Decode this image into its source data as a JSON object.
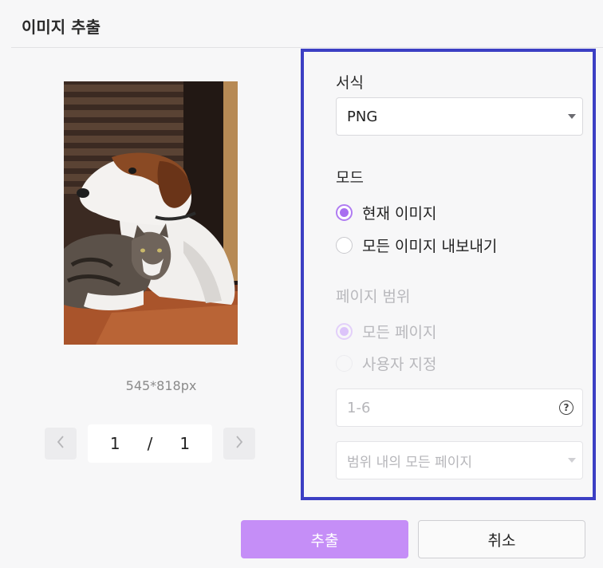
{
  "dialog": {
    "title": "이미지 추출"
  },
  "preview": {
    "image_alt": "dog-and-cat-photo",
    "dimensions": "545*818px",
    "pager": {
      "prev_icon": "chevron-left-icon",
      "next_icon": "chevron-right-icon",
      "current": "1",
      "separator": "/",
      "total": "1"
    }
  },
  "settings": {
    "format": {
      "label": "서식",
      "selected": "PNG",
      "caret_icon": "caret-down-icon"
    },
    "mode": {
      "label": "모드",
      "options": [
        {
          "label": "현재 이미지",
          "checked": true
        },
        {
          "label": "모든 이미지 내보내기",
          "checked": false
        }
      ]
    },
    "page_range": {
      "label": "페이지 범위",
      "options": [
        {
          "label": "모든 페이지",
          "checked": true
        },
        {
          "label": "사용자 지정",
          "checked": false
        }
      ],
      "custom_input_placeholder": "1-6",
      "help_icon": "help-circle-icon",
      "help_glyph": "?",
      "subset_select": "범위 내의 모든 페이지"
    }
  },
  "actions": {
    "extract_label": "추출",
    "cancel_label": "취소"
  },
  "colors": {
    "accent": "#a86ef0",
    "primary_button": "#c58ef7",
    "highlight_border": "#3c3fc4"
  }
}
